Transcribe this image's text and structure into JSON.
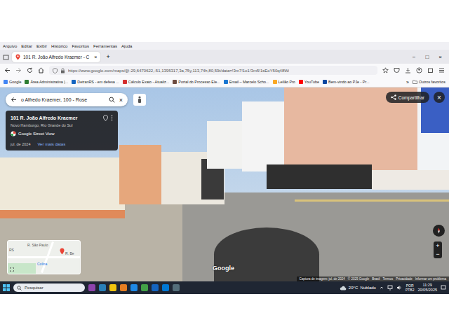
{
  "menu": [
    "Arquivo",
    "Editar",
    "Exibir",
    "Histórico",
    "Favoritos",
    "Ferramentas",
    "Ajuda"
  ],
  "window_controls": [
    "−",
    "□",
    "×"
  ],
  "tabs": [
    {
      "label": "101 R. João Alfredo Kraemer - C",
      "selected": true,
      "close": "×"
    }
  ],
  "new_tab": "+",
  "address": {
    "url": "https://www.google.com/maps/@-29,6470622,-51,1395317,3a,75y,113,74h,80,59t/data=!3m7!1e1!3m5!1sEoY50q48Wi"
  },
  "bookmarks": [
    "Google",
    "Área Administrativa |...",
    "DetranRS - em defesa ...",
    "Cálculo Exato - Atualiz...",
    "Portal do Processo Ele...",
    "Email – Marcelo Scho...",
    "Leilão Pro",
    "YouTube",
    "Bem-vindo ao PJe - Pr..."
  ],
  "bookmarks_overflow": "»",
  "other_bookmarks": "Outros favoritos",
  "maps": {
    "search": {
      "value": "o Alfredo Kraemer, 100 - Rose",
      "close": "×"
    },
    "card": {
      "title": "101 R. João Alfredo Kraemer",
      "subtitle": "Novo Hamburgo, Rio Grande do Sul",
      "source": "Google Street View",
      "date": "jul. de 2024",
      "more_dates": "Ver mais datas"
    },
    "share": "Compartilhar",
    "close": "×",
    "watermark": "Google",
    "minimap": {
      "labels": [
        "R. São Paulo",
        "Colina",
        "R. Be",
        "RS"
      ]
    },
    "zoom": [
      "+",
      "−"
    ],
    "footer": [
      "Captura de imagem: jul. de 2024",
      "© 2025 Google",
      "Brasil",
      "Termos",
      "Privacidade",
      "Informar um problema"
    ]
  },
  "taskbar": {
    "search": "Pesquisar",
    "weather": "20°C  Nublado",
    "lang": "POR",
    "layout": "PTB2",
    "time": "11:29",
    "date": "20/05/2025"
  }
}
